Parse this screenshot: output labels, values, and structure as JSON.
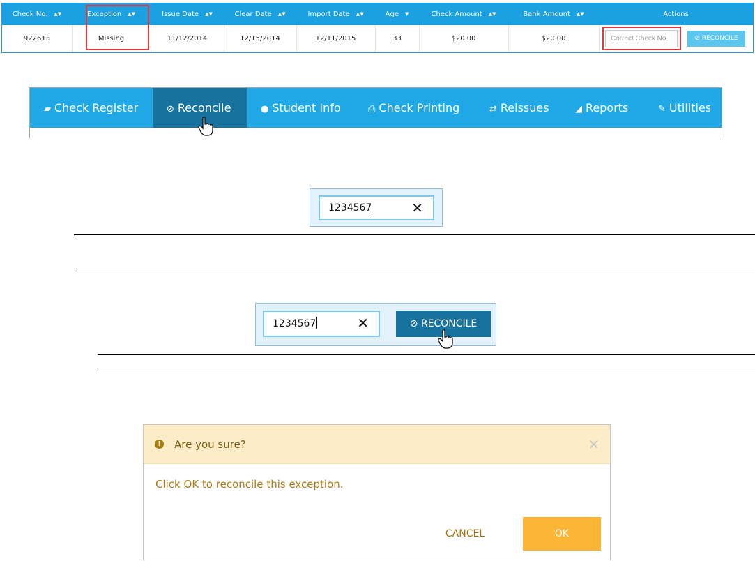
{
  "table": {
    "headers": [
      "Check No.",
      "Exception",
      "Issue Date",
      "Clear Date",
      "Import Date",
      "Age",
      "Check Amount",
      "Bank Amount",
      "Actions"
    ],
    "row": {
      "check_no": "922613",
      "exception": "Missing",
      "issue_date": "11/12/2014",
      "clear_date": "12/15/2014",
      "import_date": "12/11/2015",
      "age": "33",
      "check_amount": "$20.00",
      "bank_amount": "$20.00",
      "check_placeholder": "Correct Check No.",
      "reconcile_label": "RECONCILE"
    }
  },
  "nav": {
    "items": [
      {
        "label": "Check Register",
        "icon": "book-icon"
      },
      {
        "label": "Reconcile",
        "icon": "check-circle-icon"
      },
      {
        "label": "Student Info",
        "icon": "user-icon"
      },
      {
        "label": "Check Printing",
        "icon": "printer-icon"
      },
      {
        "label": "Reissues",
        "icon": "retweet-icon"
      },
      {
        "label": "Reports",
        "icon": "area-chart-icon"
      },
      {
        "label": "Utilities",
        "icon": "wrench-icon"
      }
    ],
    "active": "Reconcile"
  },
  "field_example": {
    "value": "1234567"
  },
  "reconcile_example": {
    "value": "1234567",
    "button_label": "RECONCILE"
  },
  "dialog": {
    "title": "Are you sure?",
    "message": "Click OK to reconcile this exception.",
    "cancel_label": "CANCEL",
    "ok_label": "OK"
  },
  "colors": {
    "header_blue": "#1ba0e2",
    "active_nav": "#17729e",
    "highlight_red": "#e23a3a",
    "dialog_header": "#fcecc8",
    "ok_orange": "#fbb637"
  }
}
